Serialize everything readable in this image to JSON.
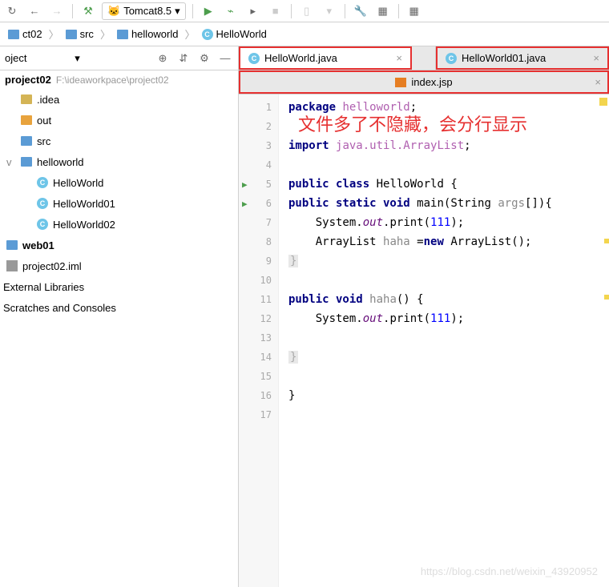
{
  "toolbar": {
    "run_config": "Tomcat8.5"
  },
  "breadcrumbs": [
    {
      "icon": "folder",
      "label": "ct02"
    },
    {
      "icon": "folder-blue",
      "label": "src"
    },
    {
      "icon": "folder-blue",
      "label": "helloworld"
    },
    {
      "icon": "class",
      "label": "HelloWorld"
    }
  ],
  "sidebar": {
    "title": "oject",
    "project_name": "project02",
    "project_path": "F:\\ideaworkpace\\project02",
    "tree": [
      {
        "indent": 0,
        "icon": "folder",
        "label": ".idea",
        "expand": ""
      },
      {
        "indent": 0,
        "icon": "folder-orange",
        "label": "out",
        "expand": ""
      },
      {
        "indent": 0,
        "icon": "folder-blue",
        "label": "src",
        "expand": ""
      },
      {
        "indent": 0,
        "icon": "folder-blue",
        "label": "helloworld",
        "expand": "v"
      },
      {
        "indent": 1,
        "icon": "class-run",
        "label": "HelloWorld",
        "expand": ""
      },
      {
        "indent": 1,
        "icon": "class",
        "label": "HelloWorld01",
        "expand": ""
      },
      {
        "indent": 1,
        "icon": "class",
        "label": "HelloWorld02",
        "expand": ""
      }
    ],
    "modules": [
      {
        "icon": "module",
        "label": "web01",
        "bold": true
      },
      {
        "icon": "iml",
        "label": "project02.iml",
        "bold": false
      }
    ],
    "external": "External Libraries",
    "scratches": "Scratches and Consoles"
  },
  "tabs": {
    "row1": [
      {
        "icon": "class-run",
        "label": "HelloWorld.java",
        "active": true,
        "redbox": true
      },
      {
        "icon": "class",
        "label": "HelloWorld01.java",
        "active": false,
        "redbox": true
      }
    ],
    "row2": {
      "icon": "jsp",
      "label": "index.jsp",
      "redbox": true
    }
  },
  "annotation": "文件多了不隐藏，会分行显示",
  "code": {
    "lines": [
      {
        "n": 1,
        "html": "<span class='k-keyword'>package</span> <span class='k-name'>helloworld</span>;"
      },
      {
        "n": 2,
        "html": ""
      },
      {
        "n": 3,
        "html": "<span class='k-keyword'>import</span> <span class='k-name'>java.util.ArrayList</span>;"
      },
      {
        "n": 4,
        "html": ""
      },
      {
        "n": 5,
        "run": true,
        "html": "<span class='k-keyword'>public class</span> <span class='k-class'>HelloWorld</span> {"
      },
      {
        "n": 6,
        "run": true,
        "html": "<span class='k-keyword'>public static void</span> <span class='k-method'>main</span>(<span class='k-class'>String</span> <span class='k-gray'>args</span>[]){"
      },
      {
        "n": 7,
        "html": "    <span class='k-class'>System</span>.<span class='k-field'>out</span>.print(<span class='k-num'>111</span>);"
      },
      {
        "n": 8,
        "html": "    <span class='k-class'>ArrayList</span> <span class='k-gray'>haha</span> =<span class='k-keyword'>new</span> <span class='k-class'>ArrayList</span>();"
      },
      {
        "n": 9,
        "html": "<span class='brace-hint'>}</span>"
      },
      {
        "n": 10,
        "html": ""
      },
      {
        "n": 11,
        "html": "<span class='k-keyword'>public void</span> <span class='k-gray'>haha</span>() {"
      },
      {
        "n": 12,
        "html": "    <span class='k-class'>System</span>.<span class='k-field'>out</span>.print(<span class='k-num'>111</span>);"
      },
      {
        "n": 13,
        "html": ""
      },
      {
        "n": 14,
        "html": "<span class='brace-hint'>}</span>"
      },
      {
        "n": 15,
        "html": ""
      },
      {
        "n": 16,
        "html": "}"
      },
      {
        "n": 17,
        "html": ""
      }
    ],
    "indents": {
      "1": 0,
      "2": 0,
      "3": 0,
      "4": 0,
      "5": 0,
      "6": 0,
      "7": 0,
      "8": 0,
      "9": 0,
      "10": 0,
      "11": 0,
      "12": 0,
      "13": 0,
      "14": 0,
      "15": 0,
      "16": 0,
      "17": 0
    }
  },
  "watermark": "https://blog.csdn.net/weixin_43920952"
}
